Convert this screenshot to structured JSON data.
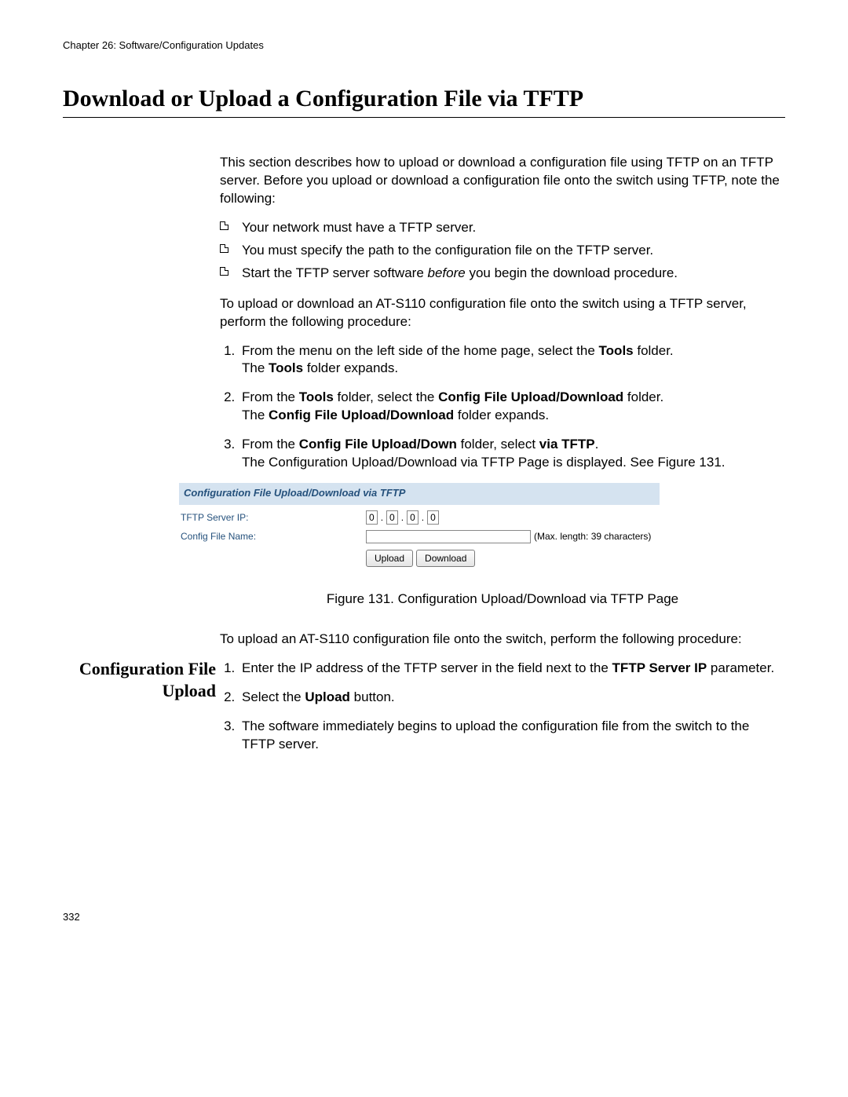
{
  "chapter_header": "Chapter 26: Software/Configuration Updates",
  "title": "Download or Upload a Configuration File via TFTP",
  "intro": "This section describes how to upload or download a configuration file using TFTP on an TFTP server. Before you upload or download a configuration file onto the switch using TFTP, note the following:",
  "bullets": {
    "b1": "Your network must have a TFTP server.",
    "b2": "You must specify the path to the configuration file on the TFTP server.",
    "b3_a": "Start the TFTP server software ",
    "b3_i": "before",
    "b3_b": " you begin the download procedure."
  },
  "lead2": "To upload or download an AT-S110 configuration file onto the switch using a TFTP server, perform the following procedure:",
  "steps": {
    "s1_a": "From the menu on the left side of the home page, select the ",
    "s1_b": "Tools",
    "s1_c": " folder.",
    "s1_d": "The ",
    "s1_e": "Tools",
    "s1_f": " folder expands.",
    "s2_a": "From the ",
    "s2_b": "Tools",
    "s2_c": " folder, select the ",
    "s2_d": "Config File Upload/Download",
    "s2_e": " folder.",
    "s2_f": "The ",
    "s2_g": "Config File Upload/Download",
    "s2_h": " folder expands.",
    "s3_a": "From the ",
    "s3_b": "Config File Upload/Down",
    "s3_c": " folder, select ",
    "s3_d": "via TFTP",
    "s3_e": ".",
    "s3_f": "The Configuration Upload/Download via TFTP Page is displayed. See Figure 131."
  },
  "figure": {
    "header": "Configuration File Upload/Download via TFTP",
    "label_ip": "TFTP Server IP:",
    "label_file": "Config File Name:",
    "ip": {
      "o1": "0",
      "o2": "0",
      "o3": "0",
      "o4": "0"
    },
    "hint": "(Max. length: 39 characters)",
    "btn_upload": "Upload",
    "btn_download": "Download",
    "caption": "Figure 131. Configuration Upload/Download via TFTP Page"
  },
  "sideheading": "Configuration File Upload",
  "upload_intro": "To upload an AT-S110 configuration file onto the switch, perform the following procedure:",
  "upload_steps": {
    "u1_a": "Enter the IP address of the TFTP server in the field next to the ",
    "u1_b": "TFTP Server IP",
    "u1_c": " parameter.",
    "u2_a": "Select the ",
    "u2_b": "Upload",
    "u2_c": " button.",
    "u3": "The software immediately begins to upload the configuration file from the switch to the TFTP server."
  },
  "page_number": "332"
}
